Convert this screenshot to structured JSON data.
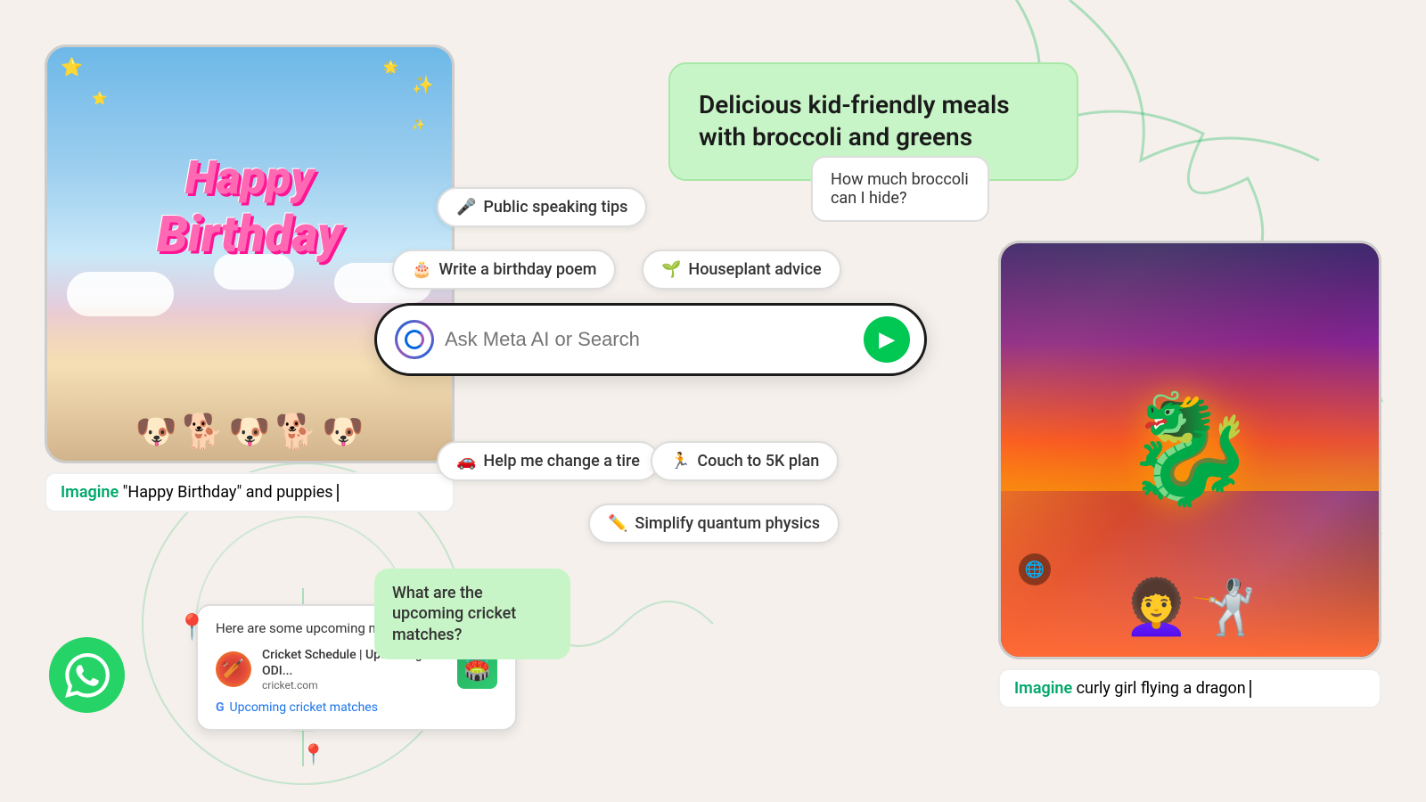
{
  "app": {
    "title": "Meta AI",
    "background_color": "#f5f0eb"
  },
  "search_bar": {
    "placeholder": "Ask Meta AI or Search",
    "submit_label": "▶"
  },
  "pills": [
    {
      "id": "public-speaking",
      "emoji": "🎤",
      "label": "Public speaking tips"
    },
    {
      "id": "birthday-poem",
      "emoji": "🎂",
      "label": "Write a birthday poem"
    },
    {
      "id": "houseplant",
      "emoji": "🌱",
      "label": "Houseplant advice"
    },
    {
      "id": "change-tire",
      "emoji": "🚗",
      "label": "Help me change a tire"
    },
    {
      "id": "couch-5k",
      "emoji": "🏃",
      "label": "Couch to 5K plan"
    },
    {
      "id": "quantum",
      "emoji": "✏️",
      "label": "Simplify quantum physics"
    }
  ],
  "birthday_card": {
    "happy_text": "Happy",
    "birthday_text": "Birthday",
    "imagine_label": "Imagine",
    "imagine_text": "\"Happy Birthday\" and puppies"
  },
  "dragon_card": {
    "imagine_label": "Imagine",
    "imagine_text": "curly girl flying a dragon"
  },
  "green_bubble": {
    "text": "Delicious kid-friendly meals with broccoli and greens"
  },
  "broccoli_bubble": {
    "text": "How much broccoli can I hide?"
  },
  "cricket_card": {
    "header": "Here are some upcoming matches:",
    "result_title": "Cricket Schedule | Upcoming ODI...",
    "result_url": "cricket.com",
    "google_link": "Upcoming cricket matches"
  },
  "cricket_question": {
    "text": "What are the upcoming cricket matches?"
  },
  "whatsapp": {
    "label": "WhatsApp"
  }
}
